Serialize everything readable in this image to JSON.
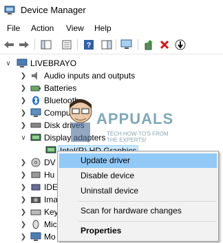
{
  "window": {
    "title": "Device Manager"
  },
  "menu": [
    {
      "label": "File"
    },
    {
      "label": "Action"
    },
    {
      "label": "View"
    },
    {
      "label": "Help"
    }
  ],
  "tree": {
    "root": "LIVEBRAYO",
    "items": [
      {
        "label": "Audio inputs and outputs",
        "icon": "speaker-icon"
      },
      {
        "label": "Batteries",
        "icon": "battery-icon"
      },
      {
        "label": "Bluetooth",
        "icon": "bluetooth-icon"
      },
      {
        "label": "Computer",
        "icon": "computer-icon"
      },
      {
        "label": "Disk drives",
        "icon": "disk-drive-icon"
      },
      {
        "label": "Display adapters",
        "icon": "display-adapter-icon",
        "expanded": true
      },
      {
        "label": "Intel(R) HD Graphics",
        "icon": "display-adapter-icon",
        "child": true,
        "selected": true
      },
      {
        "label": "DV",
        "icon": "dvd-icon"
      },
      {
        "label": "Hu",
        "icon": "hid-icon"
      },
      {
        "label": "IDE",
        "icon": "ide-icon"
      },
      {
        "label": "Ima",
        "icon": "camera-icon"
      },
      {
        "label": "Key",
        "icon": "keyboard-icon"
      },
      {
        "label": "Mic",
        "icon": "mouse-icon"
      },
      {
        "label": "Mo",
        "icon": "monitor-icon"
      }
    ]
  },
  "context_menu": {
    "update": "Update driver",
    "disable": "Disable device",
    "uninstall": "Uninstall device",
    "scan": "Scan for hardware changes",
    "properties": "Properties"
  },
  "watermark": {
    "brand": "APPUALS",
    "line1": "TECH HOW-TO'S FROM",
    "line2": "THE EXPERTS!"
  },
  "colors": {
    "highlight": "#91c9f7",
    "selection": "#cce8ff"
  }
}
